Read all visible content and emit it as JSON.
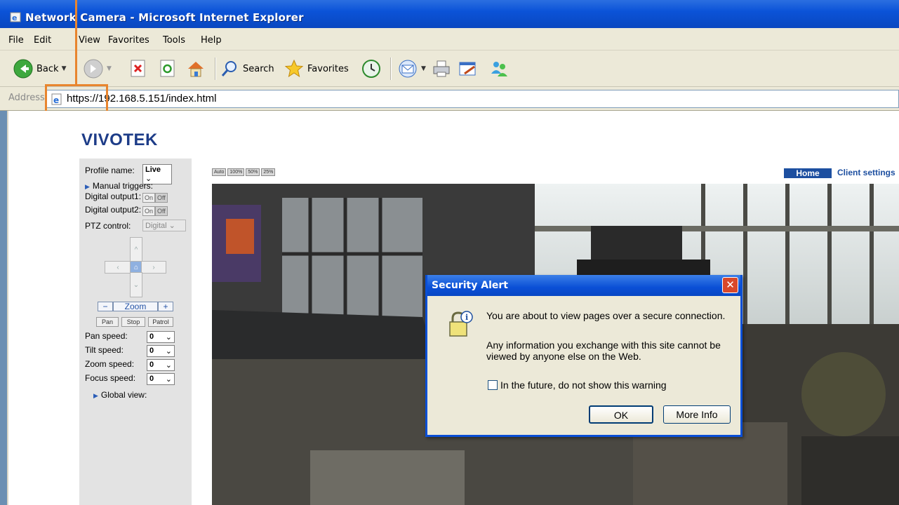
{
  "window": {
    "title": "Network Camera - Microsoft Internet Explorer"
  },
  "menu": {
    "items": [
      "File",
      "Edit",
      "View",
      "Favorites",
      "Tools",
      "Help"
    ]
  },
  "toolbar": {
    "back_label": "Back",
    "search_label": "Search",
    "favorites_label": "Favorites"
  },
  "address": {
    "label": "Address",
    "url": "https://192.168.5.151/index.html"
  },
  "page": {
    "logo": "VIVOTEK",
    "size_buttons": [
      "Auto",
      "100%",
      "50%",
      "25%"
    ],
    "nav": {
      "home": "Home",
      "client_settings": "Client settings"
    },
    "panel": {
      "profile_label": "Profile name:",
      "profile_value": "Live",
      "manual_triggers": "Manual triggers:",
      "do1_label": "Digital output1:",
      "do2_label": "Digital output2:",
      "on": "On",
      "off": "Off",
      "ptz_label": "PTZ control:",
      "ptz_value": "Digital",
      "zoom_label": "Zoom",
      "zoom_minus": "−",
      "zoom_plus": "+",
      "pan_btn": "Pan",
      "stop_btn": "Stop",
      "patrol_btn": "Patrol",
      "pan_speed_label": "Pan speed:",
      "tilt_speed_label": "Tilt speed:",
      "zoom_speed_label": "Zoom speed:",
      "focus_speed_label": "Focus speed:",
      "pan_speed": "0",
      "tilt_speed": "0",
      "zoom_speed": "0",
      "focus_speed": "0",
      "global_view": "Global view:"
    }
  },
  "dialog": {
    "title": "Security Alert",
    "line1": "You are about to view pages over a secure connection.",
    "line2a": "Any information you exchange with this site cannot be",
    "line2b": "viewed by anyone else on the Web.",
    "checkbox_label": "In the future, do not show this warning",
    "ok": "OK",
    "more_info": "More Info"
  },
  "colors": {
    "callout": "#e8852e",
    "xp_blue": "#0a4fd6",
    "vivotek_blue": "#1d3c88"
  }
}
